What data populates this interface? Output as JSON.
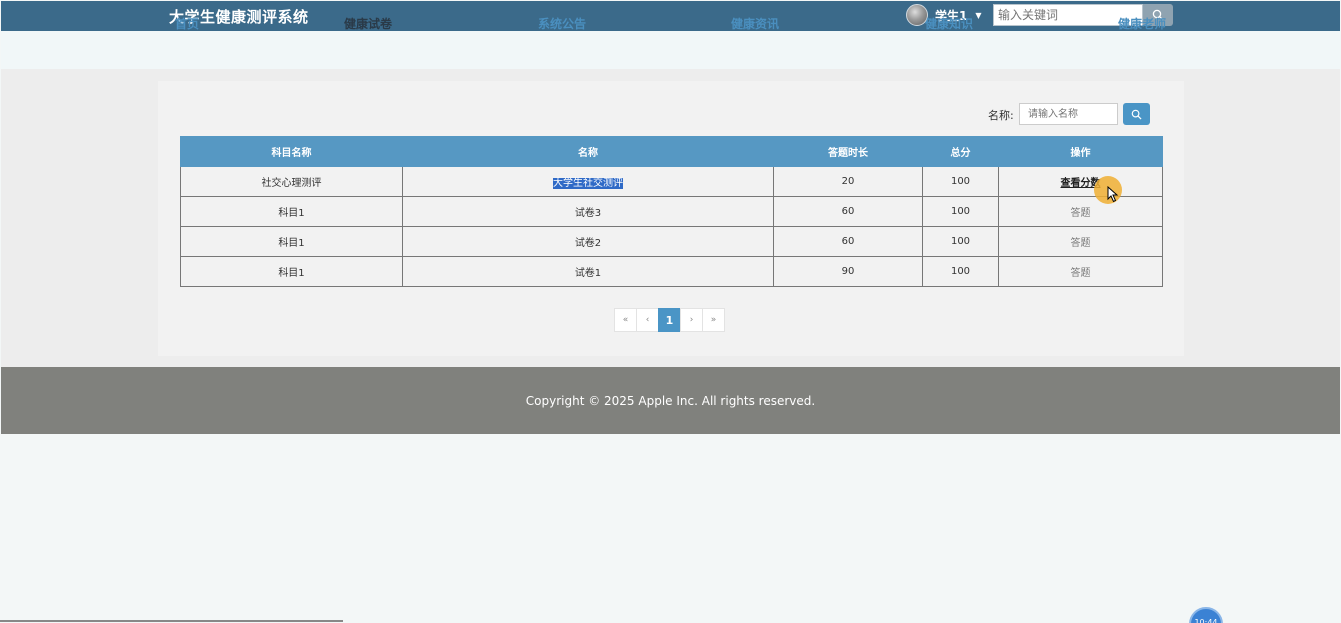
{
  "header": {
    "site_title": "大学生健康测评系统",
    "user_name": "学生1",
    "search_placeholder": "输入关键词"
  },
  "nav": {
    "items": [
      {
        "label": "首页",
        "active": false
      },
      {
        "label": "健康试卷",
        "active": true
      },
      {
        "label": "系统公告",
        "active": false
      },
      {
        "label": "健康资讯",
        "active": false
      },
      {
        "label": "健康知识",
        "active": false
      },
      {
        "label": "健康老师",
        "active": false
      }
    ]
  },
  "filter": {
    "label": "名称:",
    "placeholder": "请输入名称"
  },
  "table": {
    "columns": [
      "科目名称",
      "名称",
      "答题时长",
      "总分",
      "操作"
    ],
    "rows": [
      {
        "subject": "社交心理测评",
        "name": "大学生社交测评",
        "duration": "20",
        "score": "100",
        "action": "查看分数"
      },
      {
        "subject": "科目1",
        "name": "试卷3",
        "duration": "60",
        "score": "100",
        "action": "答题"
      },
      {
        "subject": "科目1",
        "name": "试卷2",
        "duration": "60",
        "score": "100",
        "action": "答题"
      },
      {
        "subject": "科目1",
        "name": "试卷1",
        "duration": "90",
        "score": "100",
        "action": "答题"
      }
    ]
  },
  "pagination": {
    "first": "«",
    "prev": "‹",
    "current": "1",
    "next": "›",
    "last": "»"
  },
  "footer": {
    "copyright": "Copyright © 2025 Apple Inc. All rights reserved."
  },
  "taskbar": {
    "clock": "10:44"
  },
  "icons": {
    "search": "search-icon",
    "avatar": "avatar",
    "caret": "caret-down-icon",
    "cursor": "mouse-cursor-icon"
  },
  "colors": {
    "header_bg": "#3b6a8a",
    "nav_link": "#4a8fbf",
    "table_header": "#5698c3",
    "primary_button": "#4a95c6",
    "footer_bg": "#80817d"
  }
}
